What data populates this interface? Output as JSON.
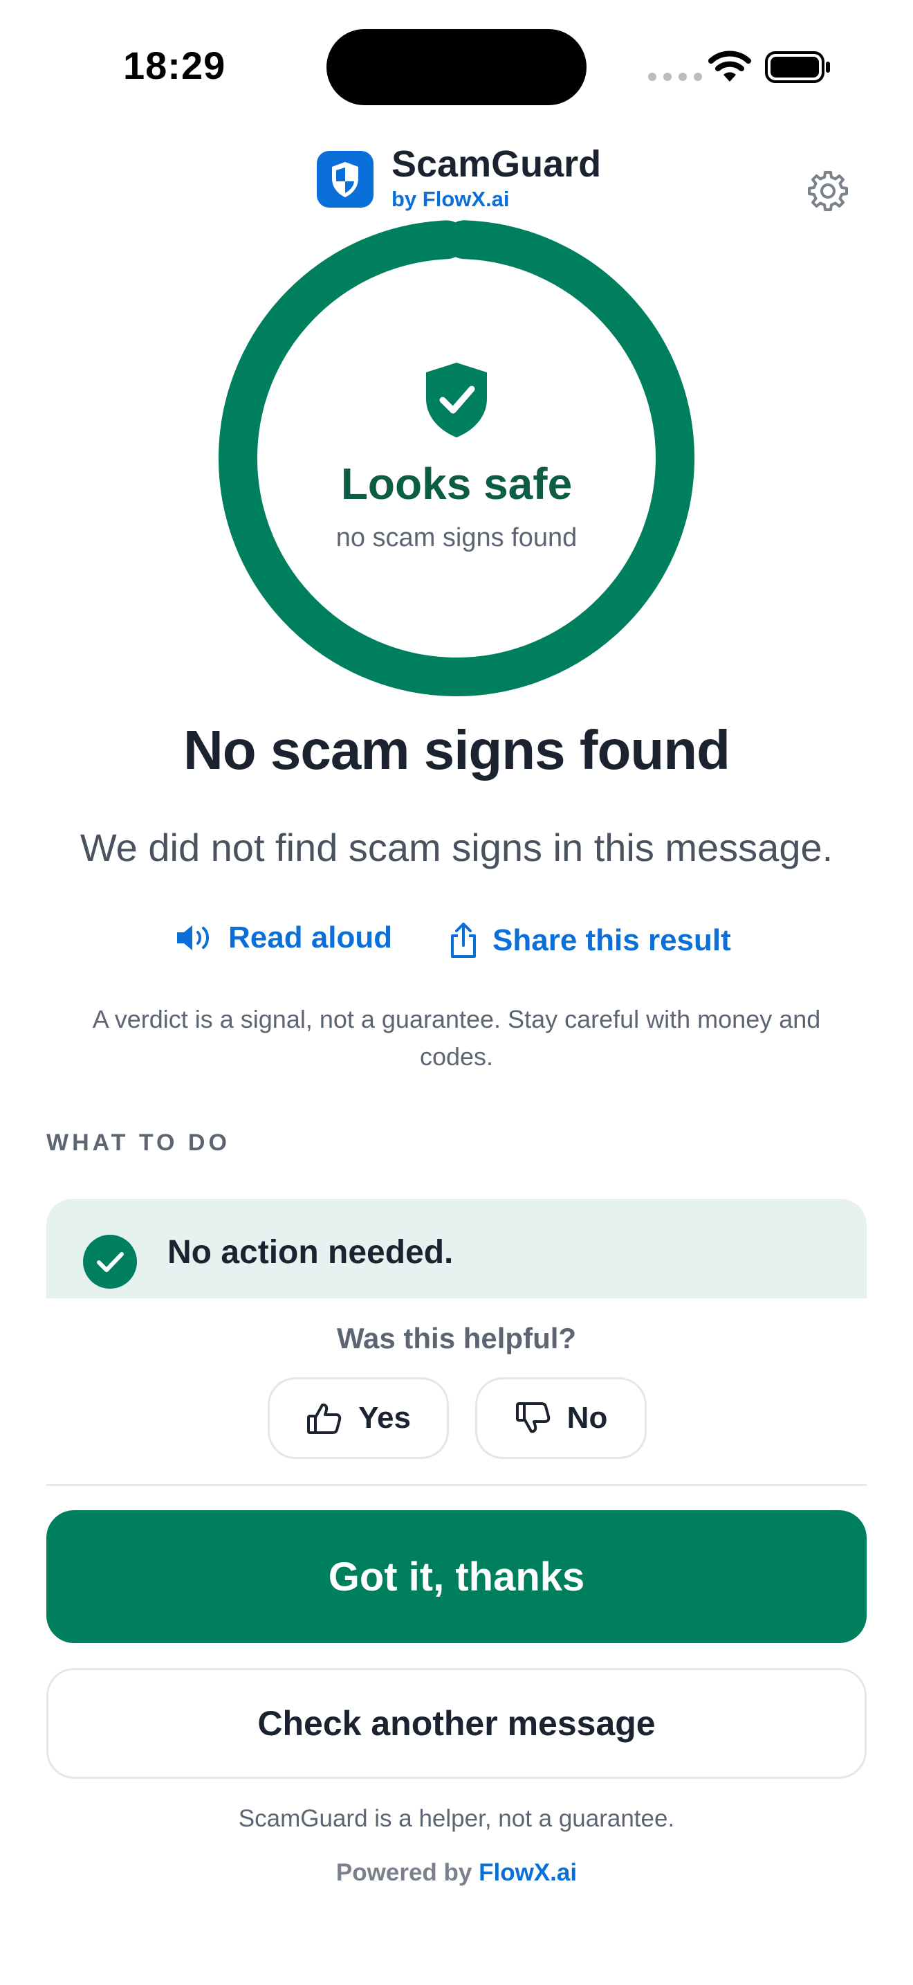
{
  "status_bar": {
    "time": "18:29"
  },
  "header": {
    "app_name": "ScamGuard",
    "by_line": "by FlowX.ai"
  },
  "verdict": {
    "ring_title": "Looks safe",
    "ring_subtitle": "no scam signs found",
    "headline": "No scam signs found",
    "description": "We did not find scam signs in this message."
  },
  "actions": {
    "read_aloud": "Read aloud",
    "share": "Share this result"
  },
  "disclaimer": "A verdict is a signal, not a guarantee. Stay careful with money and codes.",
  "what_to_do": {
    "label": "WHAT TO DO",
    "item": "No action needed."
  },
  "feedback": {
    "question": "Was this helpful?",
    "yes": "Yes",
    "no": "No"
  },
  "buttons": {
    "primary": "Got it, thanks",
    "secondary": "Check another message"
  },
  "footer": {
    "note": "ScamGuard is a helper, not a guarantee.",
    "powered_prefix": "Powered by",
    "powered_brand": "FlowX.ai"
  },
  "colors": {
    "safe_green": "#007f5f",
    "brand_blue": "#0a6fd9",
    "dark_green_text": "#0d5c45"
  }
}
